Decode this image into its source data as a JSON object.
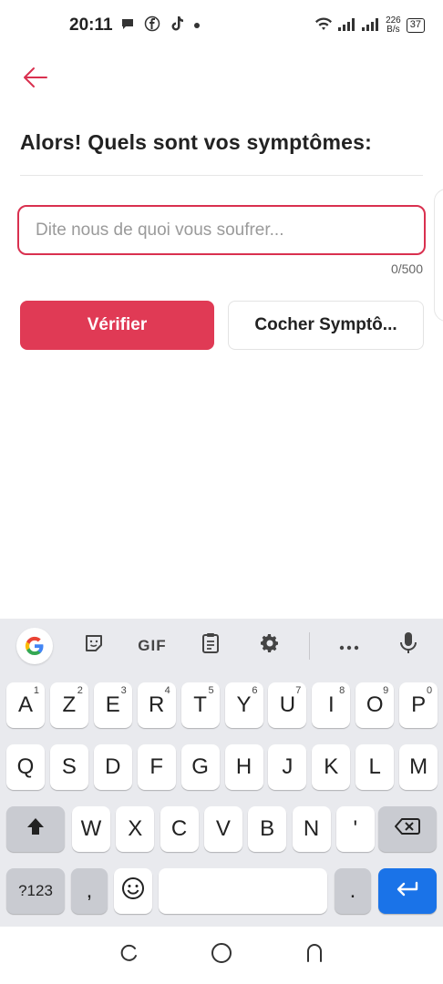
{
  "status_bar": {
    "time": "20:11",
    "net_speed_value": "226",
    "net_speed_unit": "B/s",
    "battery": "37"
  },
  "page": {
    "title": "Alors! Quels sont vos symptômes:",
    "input_placeholder": "Dite nous de quoi vous soufrer...",
    "input_value": "",
    "char_count": "0/500",
    "verify_label": "Vérifier",
    "check_label": "Cocher Symptô..."
  },
  "keyboard": {
    "toolbar": {
      "gif_label": "GIF"
    },
    "row1": [
      {
        "k": "A",
        "s": "1"
      },
      {
        "k": "Z",
        "s": "2"
      },
      {
        "k": "E",
        "s": "3"
      },
      {
        "k": "R",
        "s": "4"
      },
      {
        "k": "T",
        "s": "5"
      },
      {
        "k": "Y",
        "s": "6"
      },
      {
        "k": "U",
        "s": "7"
      },
      {
        "k": "I",
        "s": "8"
      },
      {
        "k": "O",
        "s": "9"
      },
      {
        "k": "P",
        "s": "0"
      }
    ],
    "row2": [
      "Q",
      "S",
      "D",
      "F",
      "G",
      "H",
      "J",
      "K",
      "L",
      "M"
    ],
    "row3": [
      "W",
      "X",
      "C",
      "V",
      "B",
      "N",
      "'"
    ],
    "symbols_label": "?123",
    "comma": ",",
    "period": "."
  },
  "colors": {
    "accent": "#e03a55",
    "input_border": "#d9304f",
    "enter_key": "#1a73e8"
  }
}
